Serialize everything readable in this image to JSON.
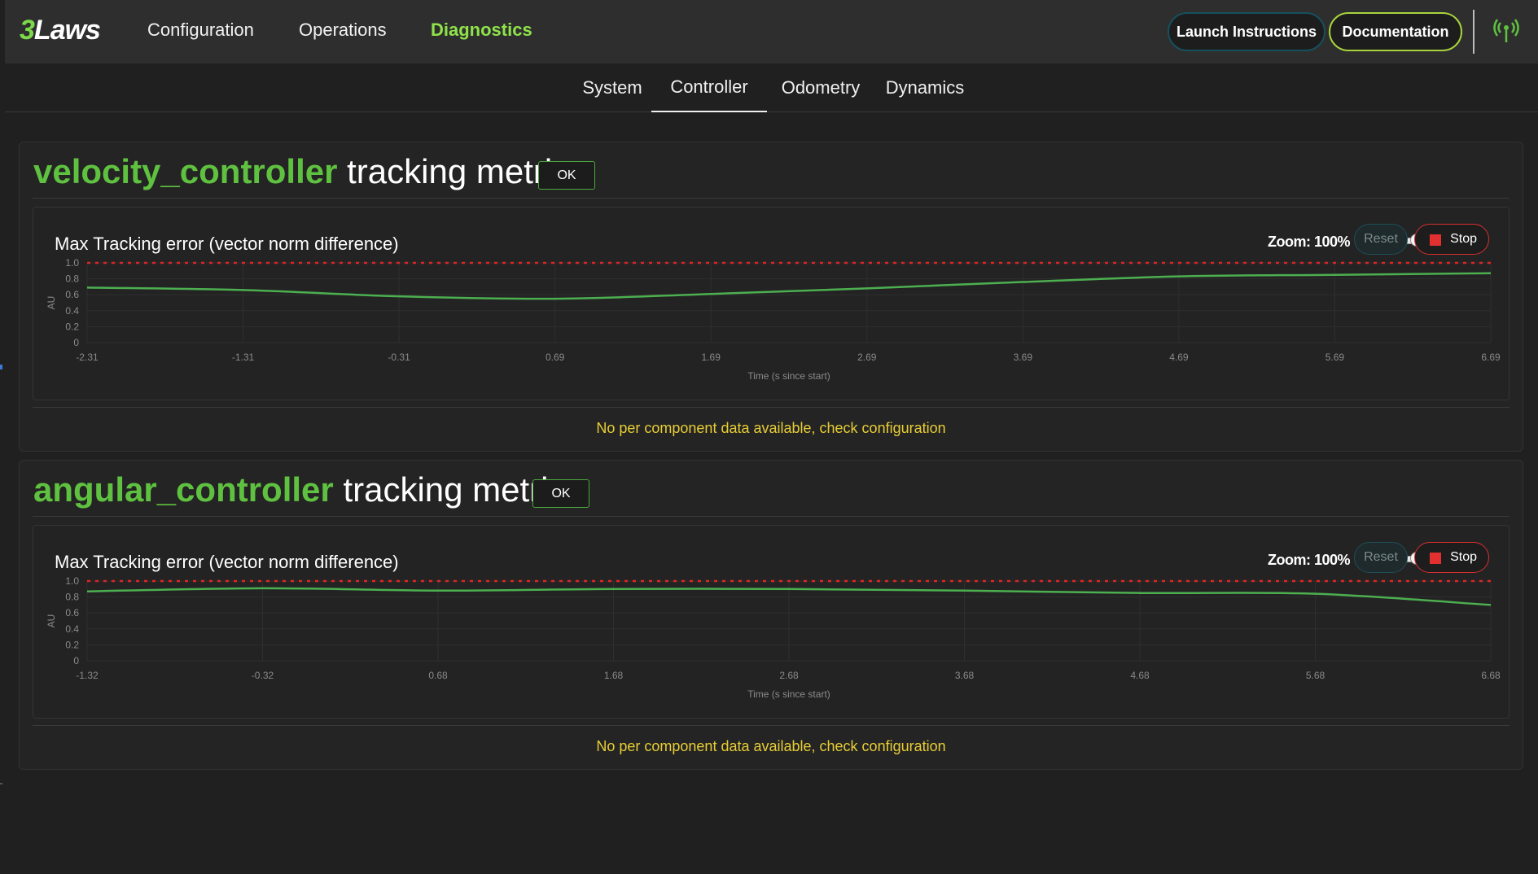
{
  "app": {
    "logo_number": "3",
    "logo_word": "Laws",
    "nav": [
      {
        "label": "Configuration",
        "active": false
      },
      {
        "label": "Operations",
        "active": false
      },
      {
        "label": "Diagnostics",
        "active": true
      }
    ],
    "buttons": {
      "launch": "Launch Instructions",
      "docs": "Documentation"
    },
    "status_icon": "radio-tower-icon"
  },
  "subnav": {
    "tabs": [
      {
        "label": "System",
        "active": false
      },
      {
        "label": "Controller",
        "active": true
      },
      {
        "label": "Odometry",
        "active": false
      },
      {
        "label": "Dynamics",
        "active": false
      }
    ]
  },
  "sections": [
    {
      "controller": "velocity_controller",
      "title_rest": "tracking metrics",
      "status": "OK",
      "chart_title": "Max Tracking error (vector norm difference)",
      "zoom_label": "Zoom: 100%",
      "zoom_level": 0.5,
      "reset_label": "Reset",
      "stop_label": "Stop",
      "warning": "No per component data available, check configuration"
    },
    {
      "controller": "angular_controller",
      "title_rest": "tracking metrics",
      "status": "OK",
      "chart_title": "Max Tracking error (vector norm difference)",
      "zoom_label": "Zoom: 100%",
      "zoom_level": 0.5,
      "reset_label": "Reset",
      "stop_label": "Stop",
      "warning": "No per component data available, check configuration"
    }
  ],
  "chart_data": [
    {
      "type": "line",
      "xlabel": "Time (s since start)",
      "ylabel": "AU",
      "xlim": [
        -2.31,
        6.69
      ],
      "ylim": [
        0,
        1.0
      ],
      "x_ticks": [
        "-2.31",
        "-1.31",
        "-0.31",
        "0.69",
        "1.69",
        "2.69",
        "3.69",
        "4.69",
        "5.69",
        "6.69"
      ],
      "y_ticks": [
        "0",
        "0.2",
        "0.4",
        "0.6",
        "0.8",
        "1.0"
      ],
      "threshold": 1.0,
      "series": [
        {
          "color": "#4caf50",
          "x": [
            -2.31,
            -1.31,
            -0.31,
            0.69,
            1.69,
            2.69,
            3.69,
            4.69,
            5.69,
            6.69
          ],
          "y": [
            0.69,
            0.66,
            0.58,
            0.55,
            0.61,
            0.68,
            0.76,
            0.83,
            0.85,
            0.87
          ]
        }
      ],
      "threshold_color": "#e02424",
      "grid": true
    },
    {
      "type": "line",
      "xlabel": "Time (s since start)",
      "ylabel": "AU",
      "xlim": [
        -1.32,
        6.68
      ],
      "ylim": [
        0,
        1.0
      ],
      "x_ticks": [
        "-1.32",
        "-0.32",
        "0.68",
        "1.68",
        "2.68",
        "3.68",
        "4.68",
        "5.68",
        "6.68"
      ],
      "y_ticks": [
        "0",
        "0.2",
        "0.4",
        "0.6",
        "0.8",
        "1.0"
      ],
      "threshold": 1.0,
      "series": [
        {
          "color": "#4caf50",
          "x": [
            -1.32,
            -0.32,
            0.68,
            1.68,
            2.68,
            3.68,
            4.68,
            5.68,
            6.68
          ],
          "y": [
            0.87,
            0.91,
            0.88,
            0.9,
            0.9,
            0.88,
            0.85,
            0.84,
            0.7
          ]
        }
      ],
      "threshold_color": "#e02424",
      "grid": true
    }
  ]
}
